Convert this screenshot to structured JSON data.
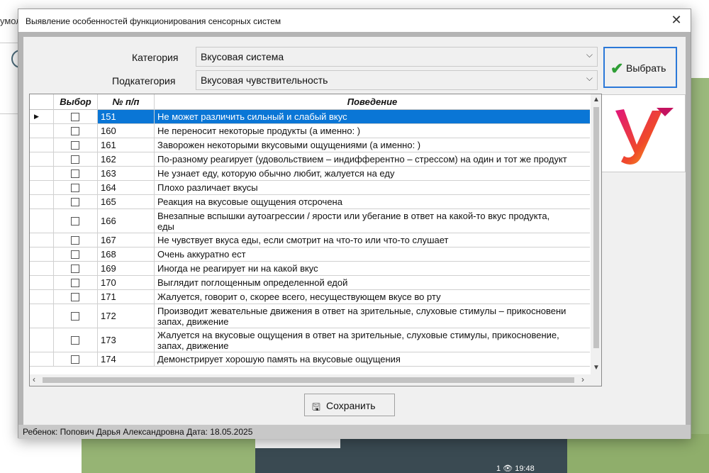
{
  "background": {
    "side_text": "умол",
    "time": "1 👁 19:48"
  },
  "dialog": {
    "title": "Выявление особенностей функционирования сенсорных систем",
    "close_symbol": "✕"
  },
  "filters": {
    "category_label": "Категория",
    "category_value": "Вкусовая система",
    "subcategory_label": "Подкатегория",
    "subcategory_value": "Вкусовая чувствительность"
  },
  "select_button": {
    "label": "Выбрать",
    "icon": "check-icon"
  },
  "grid": {
    "headers": {
      "choice": "Выбор",
      "number": "№ п/п",
      "behavior": "Поведение"
    },
    "rows": [
      {
        "num": "151",
        "text": "Не может различить сильный и слабый вкус",
        "checked": false,
        "selected": true
      },
      {
        "num": "160",
        "text": "Не переносит некоторые продукты (а именно:  )",
        "checked": false
      },
      {
        "num": "161",
        "text": "Заворожен некоторыми вкусовыми ощущениями (а именно: )",
        "checked": false
      },
      {
        "num": "162",
        "text": "По-разному реагирует (удовольствием – индифферентно – стрессом) на один и тот же продукт",
        "checked": false
      },
      {
        "num": "163",
        "text": "Не узнает еду, которую обычно любит, жалуется на еду",
        "checked": false
      },
      {
        "num": "164",
        "text": "Плохо различает вкусы",
        "checked": false
      },
      {
        "num": "165",
        "text": "Реакция на вкусовые ощущения отсрочена",
        "checked": false
      },
      {
        "num": "166",
        "text": "Внезапные вспышки аутоагрессии / ярости или убегание в ответ на какой-то вкус продукта,",
        "text2": "еды",
        "checked": false
      },
      {
        "num": "167",
        "text": "Не чувствует вкуса еды, если смотрит на что-то или что-то слушает",
        "checked": false
      },
      {
        "num": "168",
        "text": "Очень аккуратно ест",
        "checked": false
      },
      {
        "num": "169",
        "text": "Иногда не реагирует ни на какой вкус",
        "checked": false
      },
      {
        "num": "170",
        "text": "Выглядит поглощенным определенной едой",
        "checked": false
      },
      {
        "num": "171",
        "text": "Жалуется, говорит о, скорее всего, несуществующем вкусе во рту",
        "checked": false
      },
      {
        "num": "172",
        "text": "Производит жевательные движения в ответ на зрительные, слуховые стимулы – прикосновени",
        "text2": "запах, движение",
        "checked": false
      },
      {
        "num": "173",
        "text": "Жалуется на вкусовые ощущения в ответ на зрительные, слуховые стимулы, прикосновение,",
        "text2": "запах, движение",
        "checked": false
      },
      {
        "num": "174",
        "text": "Демонстрирует хорошую память на вкусовые ощущения",
        "checked": false
      }
    ]
  },
  "save_button": {
    "label": "Сохранить",
    "icon": "floppy-disk-icon"
  },
  "status": {
    "text": "Ребенок: Попович Дарья Александровна Дата: 18.05.2025"
  }
}
